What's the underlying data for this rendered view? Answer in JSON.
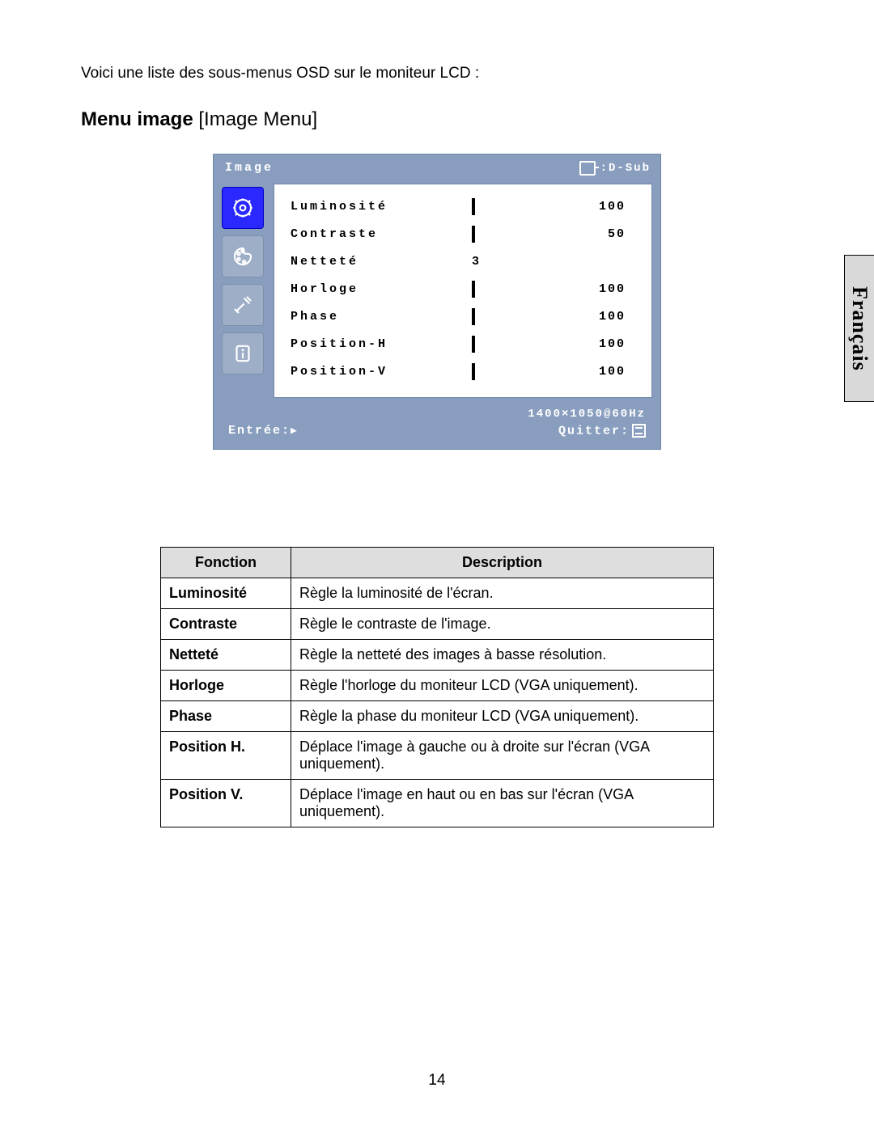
{
  "intro": "Voici une liste des sous-menus OSD sur le moniteur LCD :",
  "heading_bold": "Menu image",
  "heading_normal": " [Image Menu]",
  "lang_tab": "Français",
  "page_number": "14",
  "osd": {
    "title": "Image",
    "source": ":D-Sub",
    "resolution": "1400×1050@60Hz",
    "enter_label": "Entrée:",
    "enter_arrow": "▶",
    "quit_label": "Quitter:",
    "side_tabs": [
      "image-icon",
      "color-icon",
      "tools-icon",
      "info-icon"
    ],
    "rows": [
      {
        "label": "Luminosité",
        "value": "100",
        "bar": 100
      },
      {
        "label": "Contraste",
        "value": "50",
        "bar": 50
      },
      {
        "label": "Netteté",
        "value": "3",
        "bar": null
      },
      {
        "label": "Horloge",
        "value": "100",
        "bar": 100
      },
      {
        "label": "Phase",
        "value": "100",
        "bar": 100
      },
      {
        "label": "Position-H",
        "value": "100",
        "bar": 100
      },
      {
        "label": "Position-V",
        "value": "100",
        "bar": 100
      }
    ]
  },
  "table": {
    "headers": [
      "Fonction",
      "Description"
    ],
    "rows": [
      {
        "fn": "Luminosité",
        "desc": "Règle la luminosité de l'écran."
      },
      {
        "fn": "Contraste",
        "desc": "Règle le contraste de l'image."
      },
      {
        "fn": "Netteté",
        "desc": "Règle la netteté des images à basse résolution."
      },
      {
        "fn": "Horloge",
        "desc": "Règle l'horloge du moniteur LCD (VGA uniquement)."
      },
      {
        "fn": "Phase",
        "desc": "Règle la phase du moniteur LCD (VGA uniquement)."
      },
      {
        "fn": "Position H.",
        "desc": "Déplace l'image à gauche ou à droite sur l'écran (VGA uniquement)."
      },
      {
        "fn": "Position V.",
        "desc": "Déplace l'image en haut ou en bas sur l'écran (VGA uniquement)."
      }
    ]
  }
}
